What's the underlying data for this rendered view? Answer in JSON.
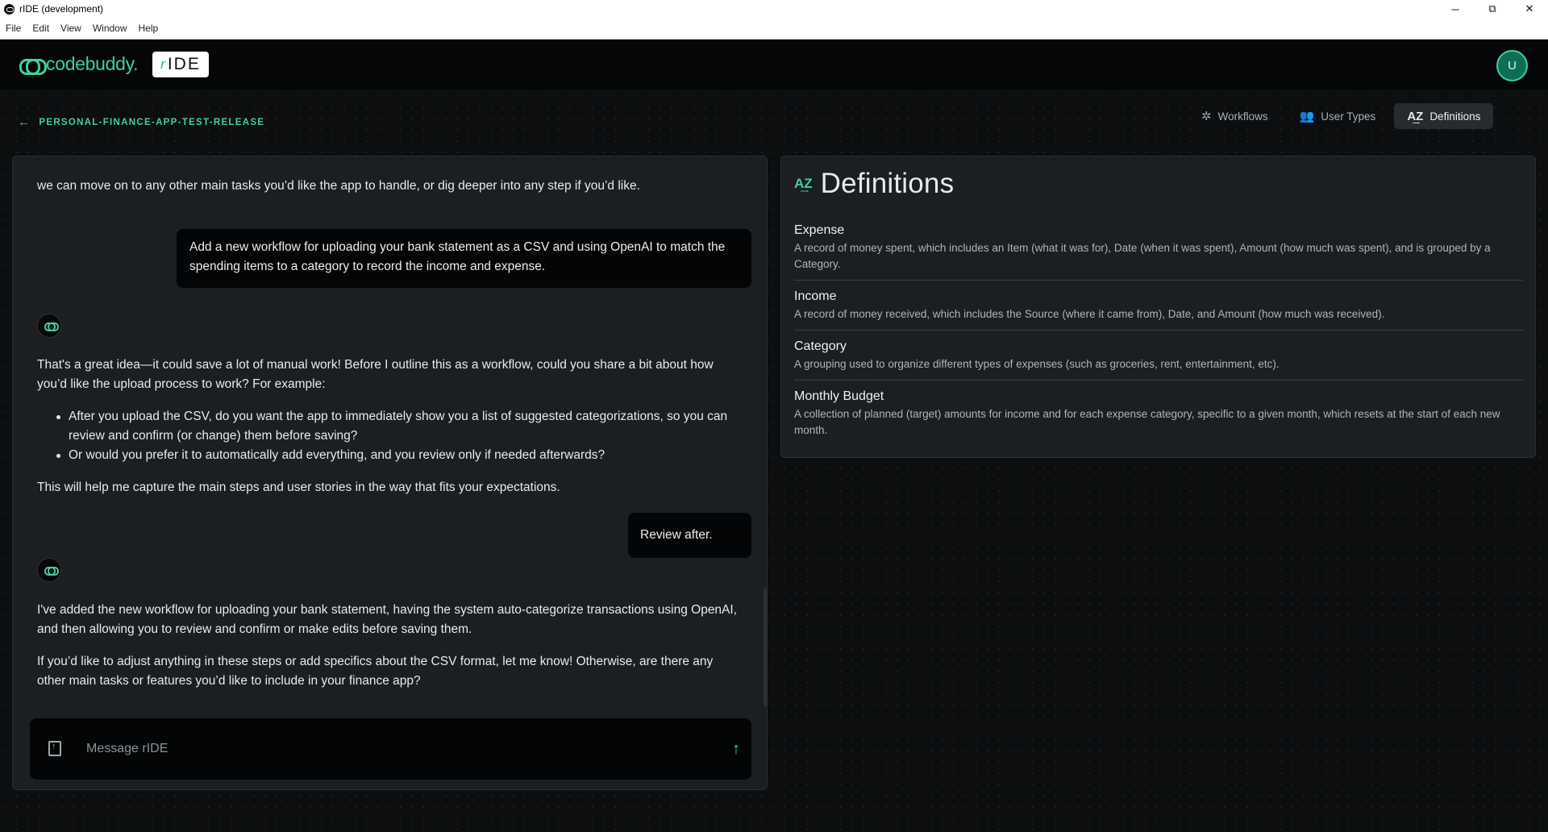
{
  "window": {
    "title": "rIDE (development)",
    "controls": {
      "minimize": "─",
      "restore": "⧉",
      "close": "✕"
    }
  },
  "menu": [
    "File",
    "Edit",
    "View",
    "Window",
    "Help"
  ],
  "header": {
    "brand": "codebuddy.",
    "product_r": "r",
    "product": "IDE",
    "avatar_initial": "U"
  },
  "project": {
    "back_icon": "←",
    "name": "PERSONAL-FINANCE-APP-TEST-RELEASE"
  },
  "tabs": [
    {
      "icon": "✲",
      "label": "Workflows",
      "active": false
    },
    {
      "icon": "👥",
      "label": "User Types",
      "active": false
    },
    {
      "icon": "A͢Z",
      "label": "Definitions",
      "active": true
    }
  ],
  "chat": {
    "messages": {
      "m0": "we can move on to any other main tasks you’d like the app to handle, or dig deeper into any step if you’d like.",
      "u1": "Add a new workflow for uploading your bank statement as a CSV and using OpenAI to match the spending items to a category to record the income and expense.",
      "a1_intro": "That's a great idea—it could save a lot of manual work! Before I outline this as a workflow, could you share a bit about how you’d like the upload process to work? For example:",
      "a1_bullets": [
        "After you upload the CSV, do you want the app to immediately show you a list of suggested categorizations, so you can review and confirm (or change) them before saving?",
        "Or would you prefer it to automatically add everything, and you review only if needed afterwards?"
      ],
      "a1_outro": "This will help me capture the main steps and user stories in the way that fits your expectations.",
      "u2": "Review after.",
      "a2_p1": "I've added the new workflow for uploading your bank statement, having the system auto-categorize transactions using OpenAI, and then allowing you to review and confirm or make edits before saving them.",
      "a2_p2": "If you’d like to adjust anything in these steps or add specifics about the CSV format, let me know! Otherwise, are there any other main tasks or features you’d like to include in your finance app?"
    },
    "composer": {
      "placeholder": "Message rIDE",
      "value": "",
      "send_icon": "↑"
    }
  },
  "definitions": {
    "icon": "A͢Z",
    "title": "Definitions",
    "items": [
      {
        "term": "Expense",
        "description": "A record of money spent, which includes an Item (what it was for), Date (when it was spent), Amount (how much was spent), and is grouped by a Category."
      },
      {
        "term": "Income",
        "description": "A record of money received, which includes the Source (where it came from), Date, and Amount (how much was received)."
      },
      {
        "term": "Category",
        "description": "A grouping used to organize different types of expenses (such as groceries, rent, entertainment, etc)."
      },
      {
        "term": "Monthly Budget",
        "description": "A collection of planned (target) amounts for income and for each expense category, specific to a given month, which resets at the start of each new month."
      }
    ]
  },
  "colors": {
    "accent": "#3fcfa0",
    "background": "#0c0e0f",
    "panel": "#1b1f21",
    "bubble": "#040506"
  }
}
